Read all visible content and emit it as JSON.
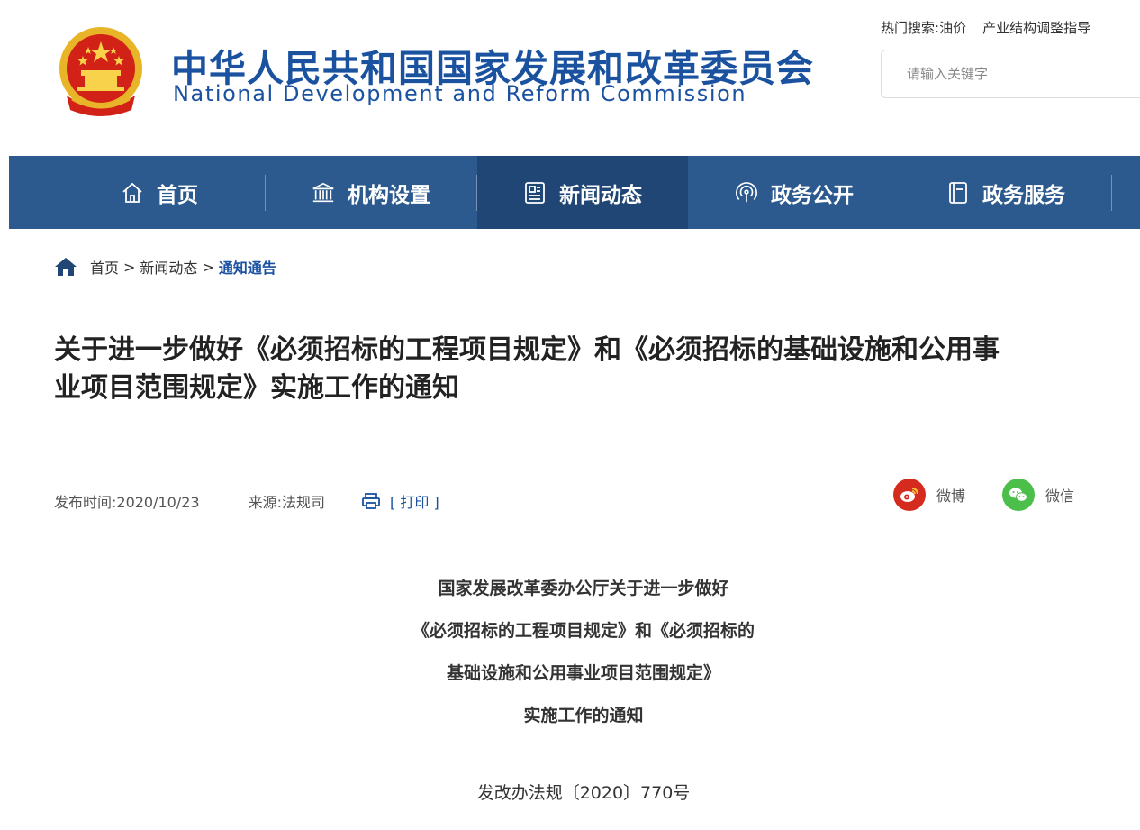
{
  "header": {
    "title_cn": "中华人民共和国国家发展和改革委员会",
    "title_en": "National Development and Reform Commission",
    "emblem_icon": "national-emblem-icon",
    "hot_search_label": "热门搜索:",
    "hot_search_terms": [
      "油价",
      "产业结构调整指导"
    ],
    "search_placeholder": "请输入关键字"
  },
  "nav": {
    "items": [
      {
        "label": "首页",
        "icon": "home-icon"
      },
      {
        "label": "机构设置",
        "icon": "building-icon"
      },
      {
        "label": "新闻动态",
        "icon": "news-icon",
        "active": true
      },
      {
        "label": "政务公开",
        "icon": "broadcast-icon"
      },
      {
        "label": "政务服务",
        "icon": "document-icon"
      }
    ]
  },
  "breadcrumb": {
    "items": [
      "首页",
      "新闻动态",
      "通知通告"
    ],
    "separator": ">"
  },
  "article": {
    "title_line1": "关于进一步做好《必须招标的工程项目规定》和《必须招标的基础设施和公用事",
    "title_line2": "业项目范围规定》实施工作的通知",
    "publish": "发布时间:2020/10/23",
    "source": "来源:法规司",
    "print": "[ 打印 ]",
    "share_weibo": "微博",
    "share_wechat": "微信",
    "head_lines": [
      "国家发展改革委办公厅关于进一步做好",
      "《必须招标的工程项目规定》和《必须招标的",
      "基础设施和公用事业项目范围规定》",
      "实施工作的通知"
    ],
    "doc_number": "发改办法规〔2020〕770号"
  },
  "colors": {
    "brand_blue": "#1a52a0",
    "nav_bg": "#2c5a8e",
    "nav_active": "#1f4674",
    "weibo_red": "#d52b1e",
    "wechat_green": "#4cbf4a"
  }
}
